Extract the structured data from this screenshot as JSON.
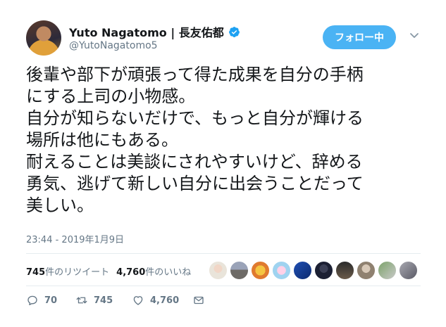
{
  "user": {
    "name": "Yuto Nagatomo | 長友佑都",
    "handle": "@YutoNagatomo5"
  },
  "follow_button": {
    "label": "フォロー中"
  },
  "tweet": {
    "text": "後輩や部下が頑張って得た成果を自分の手柄\nにする上司の小物感。\n自分が知らないだけで、もっと自分が輝ける\n場所は他にもある。\n耐えることは美談にされやすいけど、辞める\n勇気、逃げて新しい自分に出会うことだって\n美しい。",
    "timestamp": "23:44 - 2019年1月9日"
  },
  "stats": {
    "retweets_count": "745",
    "retweets_label": "件のリツイート",
    "likes_count": "4,760",
    "likes_label": "件のいいね"
  },
  "actions": {
    "reply_count": "70",
    "retweet_count": "745",
    "like_count": "4,760"
  },
  "colors": {
    "accent": "#4ab3f4",
    "verified": "#1da1f2",
    "muted": "#657786"
  }
}
